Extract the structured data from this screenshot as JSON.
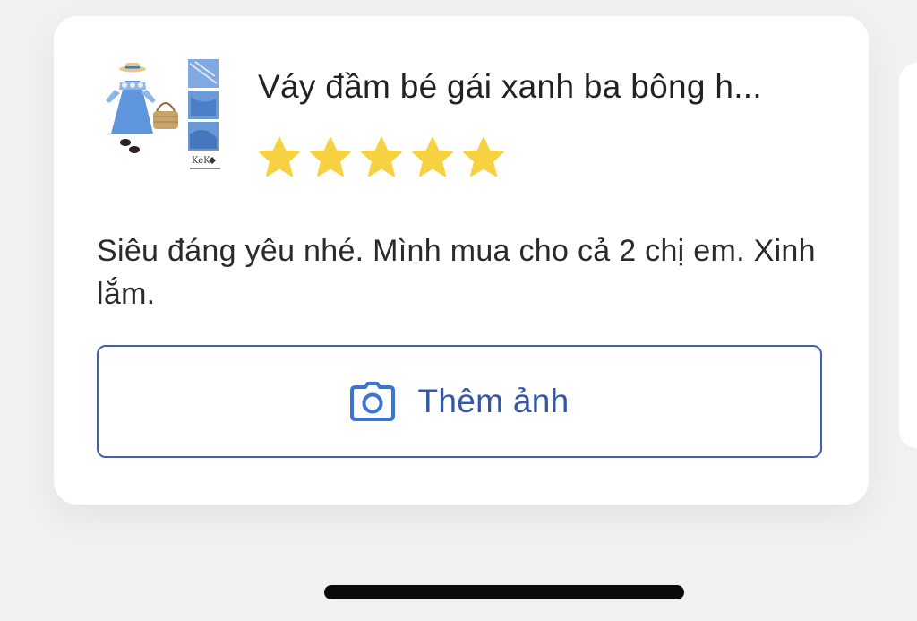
{
  "product": {
    "title": "Váy đầm bé gái xanh ba bông h...",
    "image_icon": "dress-product-photo",
    "brand_mark": "KeKo",
    "rating": 5,
    "rating_max": 5
  },
  "review": {
    "text": "Siêu đáng yêu nhé. Mình mua cho cả 2 chị em. Xinh lắm."
  },
  "add_photo": {
    "label": "Thêm ảnh",
    "icon": "camera-icon"
  },
  "colors": {
    "accent": "#3658a2",
    "star": "#f6d243",
    "dress": "#5e95dc"
  }
}
